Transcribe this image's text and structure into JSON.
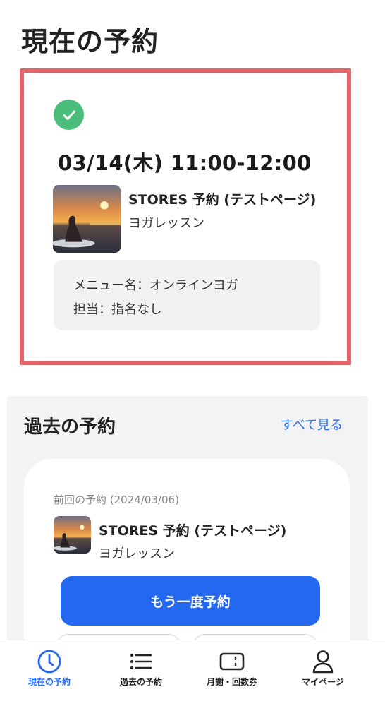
{
  "header": {
    "title": "現在の予約"
  },
  "current": {
    "datetime": "03/14(木) 11:00-12:00",
    "shop_name": "STORES 予約 (テストページ)",
    "lesson_name": "ヨガレッスン",
    "menu_line": "メニュー名：オンラインヨガ",
    "staff_line": "担当：指名なし",
    "status_color": "#4cbe7b",
    "highlight_color": "#e5636b"
  },
  "past": {
    "title": "過去の予約",
    "see_all": "すべて見る",
    "prev_label": "前回の予約 (2024/03/06)",
    "shop_name": "STORES 予約 (テストページ)",
    "lesson_name": "ヨガレッスン",
    "rebook_label": "もう一度予約",
    "accent_color": "#2468f2"
  },
  "tabs": [
    {
      "label": "現在の予約",
      "icon": "clock-icon",
      "active": true
    },
    {
      "label": "過去の予約",
      "icon": "list-icon",
      "active": false
    },
    {
      "label": "月謝・回数券",
      "icon": "ticket-icon",
      "active": false
    },
    {
      "label": "マイページ",
      "icon": "person-icon",
      "active": false
    }
  ]
}
